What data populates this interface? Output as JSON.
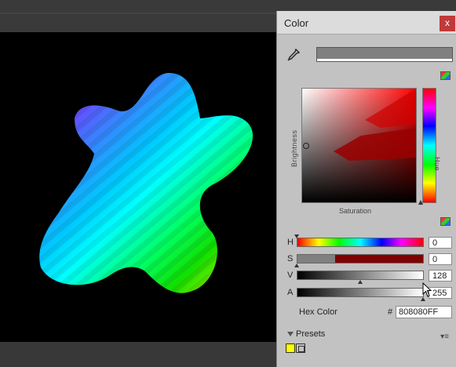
{
  "window": {
    "title": "Color",
    "close_glyph": "x"
  },
  "icons": {
    "eyedropper": "eyedropper-icon",
    "palette": "color-palette-icon"
  },
  "picker": {
    "brightness_label": "Brightness",
    "saturation_label": "Saturation",
    "hue_label": "Hue"
  },
  "sliders": [
    {
      "label": "H",
      "value": "0",
      "level": 0.0
    },
    {
      "label": "S",
      "value": "0",
      "level": 0.0
    },
    {
      "label": "V",
      "value": "128",
      "level": 0.502
    },
    {
      "label": "A",
      "value": "255",
      "level": 1.0
    }
  ],
  "hex": {
    "label": "Hex Color",
    "hash": "#",
    "value": "808080FF"
  },
  "presets": {
    "label": "Presets",
    "menu_glyph": "▾≡"
  },
  "colors": {
    "current": "#808080",
    "accent_red": "#c03a3a",
    "preset_yellow": "#ffff00"
  }
}
